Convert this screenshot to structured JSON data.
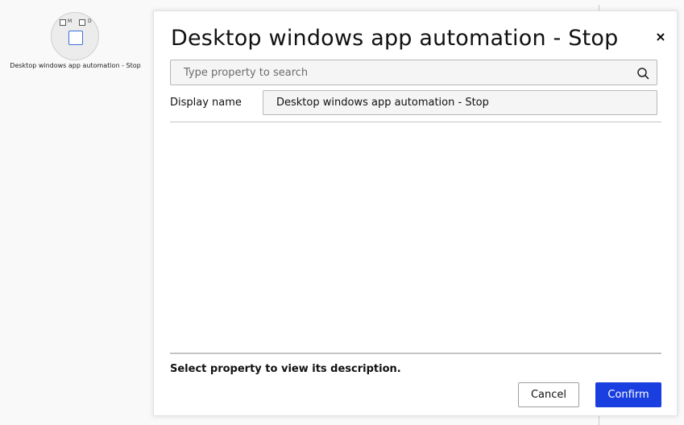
{
  "canvas": {
    "node": {
      "label": "Desktop windows app automation - Stop",
      "checkbox_m_label": "M",
      "checkbox_d_label": "D",
      "icon": "stop-square-icon"
    }
  },
  "dialog": {
    "title": "Desktop windows app automation - Stop",
    "close_symbol": "×",
    "search": {
      "placeholder": "Type property to search",
      "value": "",
      "icon": "search-icon"
    },
    "properties": [
      {
        "label": "Display name",
        "value": "Desktop windows app automation - Stop"
      }
    ],
    "description_text": "Select property to view its description.",
    "buttons": {
      "cancel_label": "Cancel",
      "confirm_label": "Confirm"
    }
  },
  "colors": {
    "accent": "#1a3fe0",
    "node_icon": "#3b6fd9"
  }
}
